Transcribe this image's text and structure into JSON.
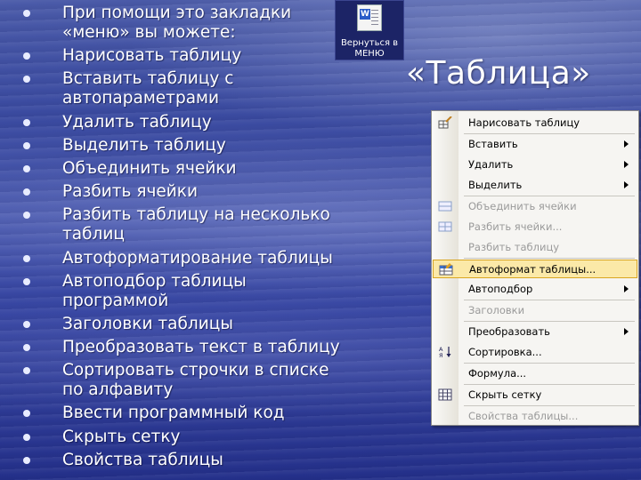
{
  "bullets": [
    "При помощи это закладки «меню» вы можете:",
    "Нарисовать таблицу",
    "Вставить таблицу с автопараметрами",
    "Удалить таблицу",
    "Выделить таблицу",
    "Объединить ячейки",
    "Разбить ячейки",
    "Разбить таблицу на несколько таблиц",
    "Автоформатирование таблицы",
    "Автоподбор таблицы программой",
    "Заголовки таблицы",
    "Преобразовать текст в таблицу",
    "Сортировать строчки в списке по алфавиту",
    "Ввести программный код",
    "Скрыть сетку",
    "Свойства таблицы"
  ],
  "back_button": {
    "label": "Вернуться в МЕНЮ",
    "icon": "word-document-icon"
  },
  "heading": "«Таблица»",
  "menu": {
    "items": [
      {
        "label": "Нарисовать таблицу",
        "icon": "pencil-table-icon",
        "disabled": false,
        "submenu": false
      },
      {
        "label": "Вставить",
        "disabled": false,
        "submenu": true
      },
      {
        "label": "Удалить",
        "disabled": false,
        "submenu": true
      },
      {
        "label": "Выделить",
        "disabled": false,
        "submenu": true
      },
      {
        "label": "Объединить ячейки",
        "icon": "merge-cells-icon",
        "disabled": true,
        "submenu": false
      },
      {
        "label": "Разбить ячейки...",
        "icon": "split-cells-icon",
        "disabled": true,
        "submenu": false
      },
      {
        "label": "Разбить таблицу",
        "disabled": true,
        "submenu": false
      },
      {
        "label": "Автоформат таблицы...",
        "icon": "autoformat-icon",
        "disabled": false,
        "submenu": false,
        "selected": true
      },
      {
        "label": "Автоподбор",
        "disabled": false,
        "submenu": true
      },
      {
        "label": "Заголовки",
        "disabled": true,
        "submenu": false
      },
      {
        "label": "Преобразовать",
        "disabled": false,
        "submenu": true
      },
      {
        "label": "Сортировка...",
        "icon": "sort-az-icon",
        "disabled": false,
        "submenu": false
      },
      {
        "label": "Формула...",
        "disabled": false,
        "submenu": false
      },
      {
        "label": "Скрыть сетку",
        "icon": "grid-icon",
        "disabled": false,
        "submenu": false
      },
      {
        "label": "Свойства таблицы...",
        "disabled": true,
        "submenu": false
      }
    ]
  },
  "colors": {
    "selection_bg": "#fbe9a8",
    "selection_border": "#d9a520",
    "text": "#ffffff"
  }
}
